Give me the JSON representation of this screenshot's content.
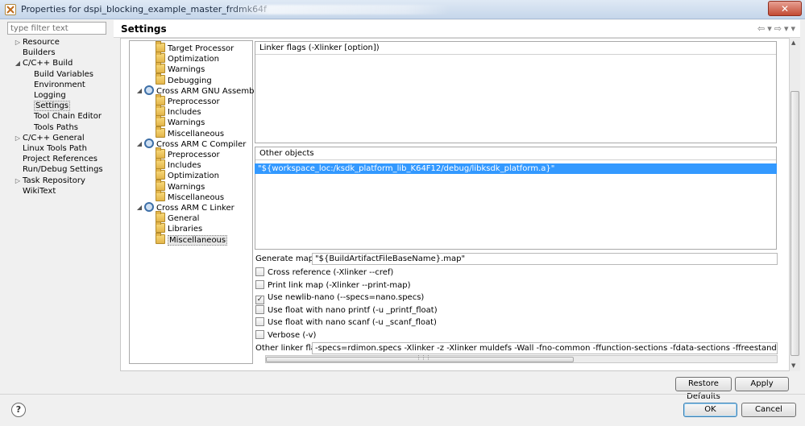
{
  "window": {
    "title": "Properties for dspi_blocking_example_master_frdmk64f",
    "close_glyph": "✕"
  },
  "filter": {
    "placeholder": "type filter text"
  },
  "nav_tree": [
    {
      "label": "Resource",
      "twisty": "▷"
    },
    {
      "label": "Builders",
      "twisty": ""
    },
    {
      "label": "C/C++ Build",
      "twisty": "◢"
    },
    {
      "label": "Build Variables",
      "twisty": ""
    },
    {
      "label": "Environment",
      "twisty": ""
    },
    {
      "label": "Logging",
      "twisty": ""
    },
    {
      "label": "Settings",
      "twisty": "",
      "selected": true
    },
    {
      "label": "Tool Chain Editor",
      "twisty": ""
    },
    {
      "label": "Tools Paths",
      "twisty": ""
    },
    {
      "label": "C/C++ General",
      "twisty": "▷"
    },
    {
      "label": "Linux Tools Path",
      "twisty": ""
    },
    {
      "label": "Project References",
      "twisty": ""
    },
    {
      "label": "Run/Debug Settings",
      "twisty": ""
    },
    {
      "label": "Task Repository",
      "twisty": "▷"
    },
    {
      "label": "WikiText",
      "twisty": ""
    }
  ],
  "settings": {
    "title": "Settings"
  },
  "tool_tree": [
    {
      "label": "Target Processor",
      "icon": "folder",
      "twisty": ""
    },
    {
      "label": "Optimization",
      "icon": "folder",
      "twisty": ""
    },
    {
      "label": "Warnings",
      "icon": "folder",
      "twisty": ""
    },
    {
      "label": "Debugging",
      "icon": "folder",
      "twisty": ""
    },
    {
      "label": "Cross ARM GNU Assembler",
      "icon": "gear",
      "twisty": "◢"
    },
    {
      "label": "Preprocessor",
      "icon": "folder",
      "twisty": ""
    },
    {
      "label": "Includes",
      "icon": "folder",
      "twisty": ""
    },
    {
      "label": "Warnings",
      "icon": "folder",
      "twisty": ""
    },
    {
      "label": "Miscellaneous",
      "icon": "folder",
      "twisty": ""
    },
    {
      "label": "Cross ARM C Compiler",
      "icon": "gear",
      "twisty": "◢"
    },
    {
      "label": "Preprocessor",
      "icon": "folder",
      "twisty": ""
    },
    {
      "label": "Includes",
      "icon": "folder",
      "twisty": ""
    },
    {
      "label": "Optimization",
      "icon": "folder",
      "twisty": ""
    },
    {
      "label": "Warnings",
      "icon": "folder",
      "twisty": ""
    },
    {
      "label": "Miscellaneous",
      "icon": "folder",
      "twisty": ""
    },
    {
      "label": "Cross ARM C Linker",
      "icon": "gear",
      "twisty": "◢"
    },
    {
      "label": "General",
      "icon": "folder",
      "twisty": ""
    },
    {
      "label": "Libraries",
      "icon": "folder",
      "twisty": ""
    },
    {
      "label": "Miscellaneous",
      "icon": "folder",
      "twisty": "",
      "selected": true
    }
  ],
  "linker_flags": {
    "label": "Linker flags (-Xlinker [option])"
  },
  "other_objects": {
    "label": "Other objects",
    "items": [
      "\"${workspace_loc:/ksdk_platform_lib_K64F12/debug/libksdk_platform.a}\""
    ]
  },
  "generate_map": {
    "label": "Generate map",
    "value": "\"${BuildArtifactFileBaseName}.map\""
  },
  "options": [
    {
      "label": "Cross reference (-Xlinker --cref)",
      "checked": false
    },
    {
      "label": "Print link map (-Xlinker --print-map)",
      "checked": false
    },
    {
      "label": "Use newlib-nano (--specs=nano.specs)",
      "checked": true
    },
    {
      "label": "Use float with nano printf (-u _printf_float)",
      "checked": false
    },
    {
      "label": "Use float with nano scanf (-u _scanf_float)",
      "checked": false
    },
    {
      "label": "Verbose (-v)",
      "checked": false
    }
  ],
  "other_linker_flags": {
    "label": "Other linker flags",
    "value": "-specs=rdimon.specs  -Xlinker -z  -Xlinker muldefs  -Wall  -fno-common  -ffunction-sections  -fdata-sections  -ffreestanding  -fno-builtin  -Os  -ma"
  },
  "buttons": {
    "restore_defaults": "Restore Defaults",
    "apply": "Apply",
    "ok": "OK",
    "cancel": "Cancel"
  },
  "help": {
    "glyph": "?"
  },
  "icons": {
    "back": "⇦",
    "dropdown": "▾",
    "forward": "⇨",
    "scroll_up": "▲",
    "scroll_down": "▼",
    "grip": "⋮⋮⋮"
  }
}
